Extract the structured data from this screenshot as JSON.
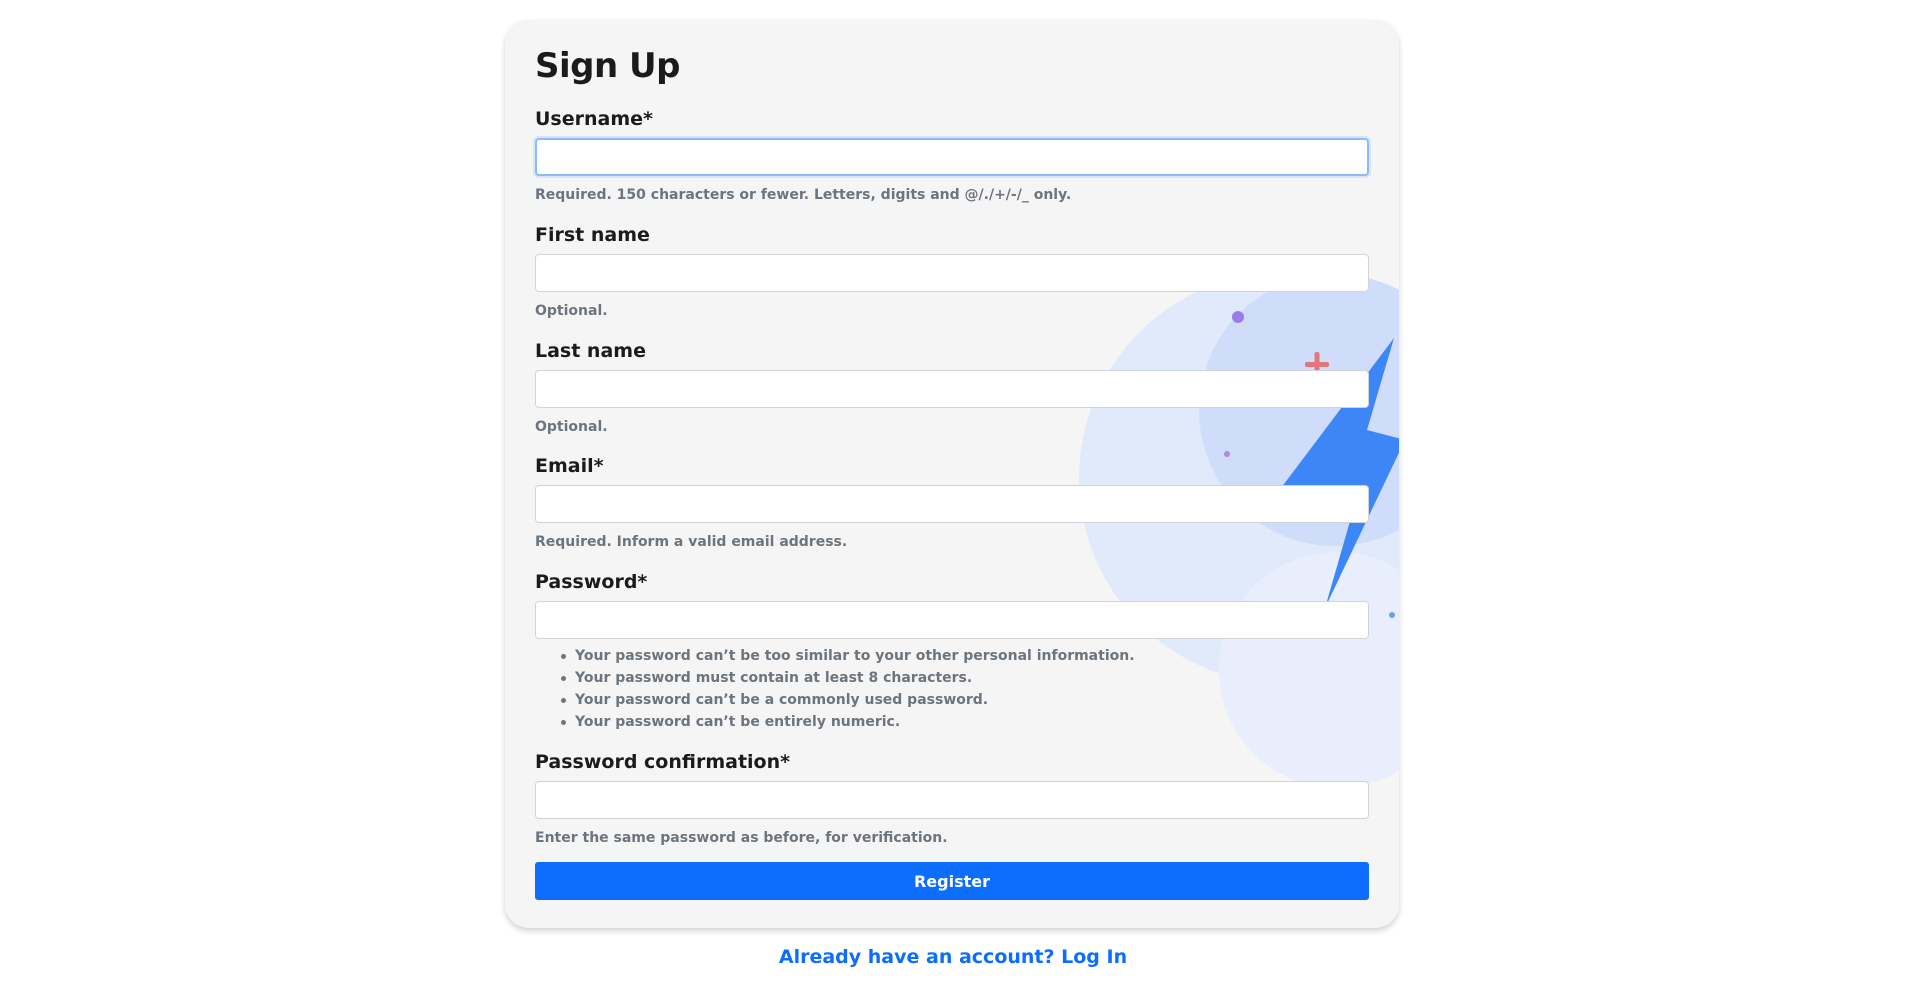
{
  "form": {
    "title": "Sign Up",
    "fields": [
      {
        "label": "Username*",
        "value": "",
        "help": "Required. 150 characters or fewer. Letters, digits and @/./+/-/_ only."
      },
      {
        "label": "First name",
        "value": "",
        "help": "Optional."
      },
      {
        "label": "Last name",
        "value": "",
        "help": "Optional."
      },
      {
        "label": "Email*",
        "value": "",
        "help": "Required. Inform a valid email address."
      },
      {
        "label": "Password*",
        "value": "",
        "rules": [
          "Your password can’t be too similar to your other personal information.",
          "Your password must contain at least 8 characters.",
          "Your password can’t be a commonly used password.",
          "Your password can’t be entirely numeric."
        ]
      },
      {
        "label": "Password confirmation*",
        "value": "",
        "help": "Enter the same password as before, for verification."
      }
    ],
    "submit_label": "Register"
  },
  "footer": {
    "login_link": "Already have an account? Log In"
  },
  "colors": {
    "accent": "#0d6efd",
    "card_bg": "#f5f5f5",
    "help_text": "#6c757d"
  },
  "decoration": {
    "icon": "lightning-bolt-icon"
  }
}
